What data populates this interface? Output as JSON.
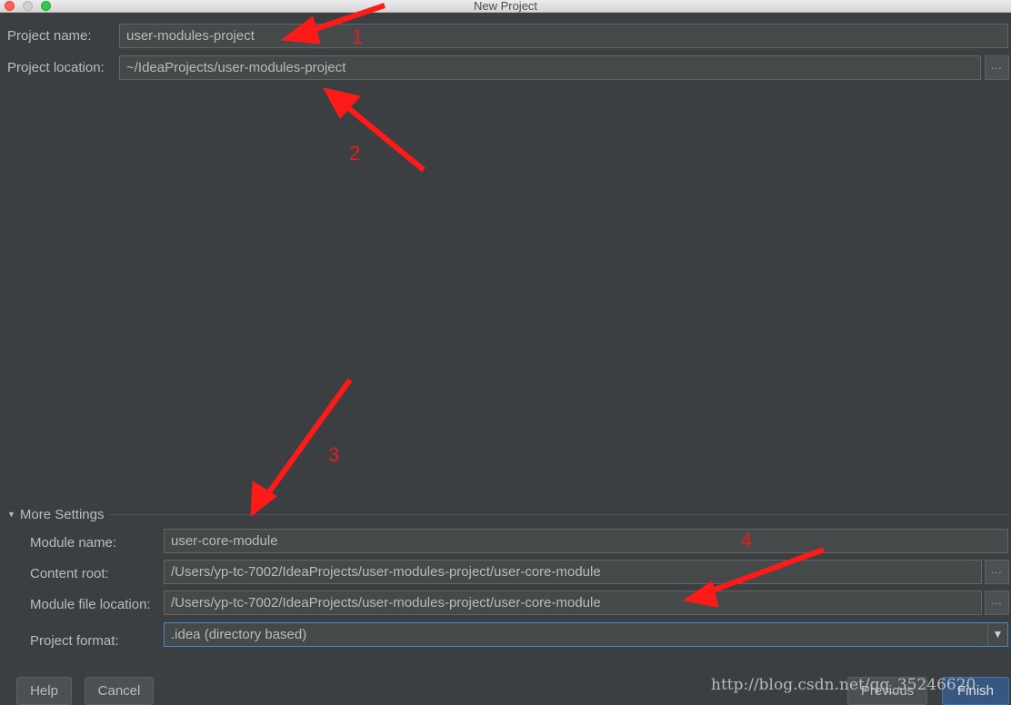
{
  "window": {
    "title": "New Project"
  },
  "project": {
    "name_label": "Project name:",
    "name_value": "user-modules-project",
    "location_label": "Project location:",
    "location_value": "~/IdeaProjects/user-modules-project",
    "browse_label": "..."
  },
  "more_settings": {
    "header": "More Settings",
    "module_name_label": "Module name:",
    "module_name_value": "user-core-module",
    "content_root_label": "Content root:",
    "content_root_value": "/Users/yp-tc-7002/IdeaProjects/user-modules-project/user-core-module",
    "module_file_label": "Module file location:",
    "module_file_value": "/Users/yp-tc-7002/IdeaProjects/user-modules-project/user-core-module",
    "project_format_label": "Project format:",
    "project_format_value": ".idea (directory based)",
    "browse_label": "..."
  },
  "buttons": {
    "help": "Help",
    "cancel": "Cancel",
    "previous": "Previous",
    "finish": "Finish"
  },
  "annotations": {
    "n1": "1",
    "n2": "2",
    "n3": "3",
    "n4": "4",
    "color": "#ff1a1a"
  },
  "watermark": "http://blog.csdn.net/qq_35246620"
}
